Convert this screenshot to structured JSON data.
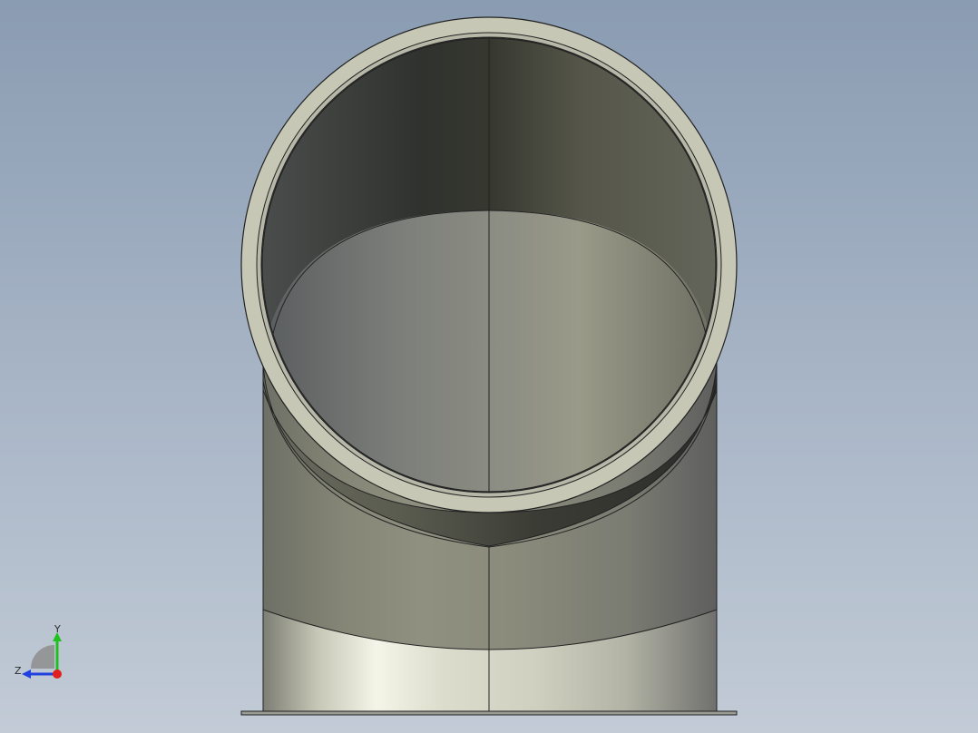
{
  "viewport": {
    "background_top": "#8a9cb2",
    "background_bottom": "#c2cbd6",
    "model": "pipe-elbow-90deg"
  },
  "triad": {
    "x_label": "",
    "y_label": "Y",
    "z_label": "Z",
    "x_color": "#e02020",
    "y_color": "#20c020",
    "z_color": "#2040e0"
  }
}
